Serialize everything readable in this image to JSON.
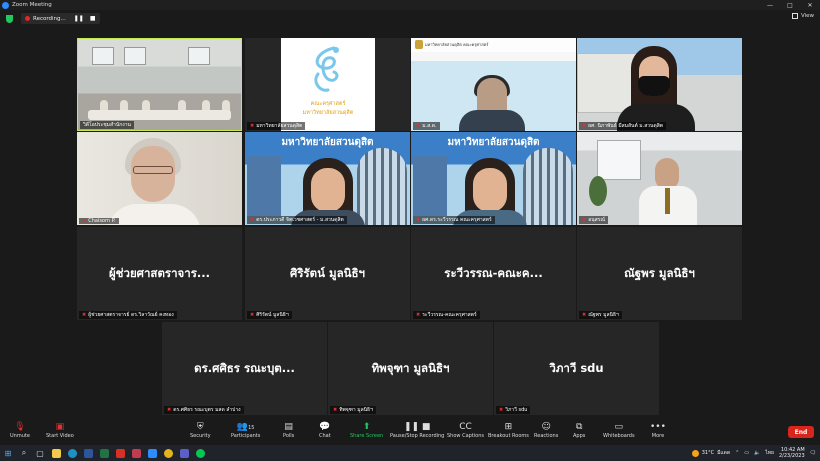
{
  "window": {
    "title": "Zoom Meeting",
    "controls": [
      "—",
      "□",
      "✕"
    ]
  },
  "recording": {
    "label": "Recording...",
    "pause_icon": "pause-icon",
    "stop_icon": "stop-icon"
  },
  "view_button": "View",
  "video_tiles": [
    {
      "name": "วิดีโอประชุมสำนักงาน",
      "scene": "office",
      "active": true
    },
    {
      "name": "มหาวิทยาลัยสวนดุสิต",
      "scene": "logo"
    },
    {
      "name": "ม.ส.ด.",
      "scene": "slide"
    },
    {
      "name": "ผศ. นิภาพันธ์ มีสมสันต์ ม.สวนดุสิต",
      "scene": "building"
    },
    {
      "name": "Chaisorn P.",
      "scene": "oldlady"
    },
    {
      "name": "ดร.ประภาวดี จิตเวชศาสตร์ - ม.สวนดุสิต",
      "scene": "suandusit1"
    },
    {
      "name": "ผศ.ดร.ระวีวรรณ คณะครุศาสตร์",
      "scene": "suandusit2"
    },
    {
      "name": "อนุสรณ์",
      "scene": "man"
    }
  ],
  "logo_text": {
    "line1": "คณะครุศาสตร์",
    "line2": "มหาวิทยาลัยสวนดุสิต"
  },
  "slide_header": "มหาวิทยาลัยสวนดุสิต คณะครุศาสตร์",
  "banner_text": "มหาวิทยาลัยสวนดุสิต",
  "name_tiles": [
    {
      "display": "ผู้ช่วยศาสตราจาร...",
      "tag": "ผู้ช่วยศาสตราจารย์ ดร.วิลาวัณย์ คงทอง"
    },
    {
      "display": "ศิริรัตน์ มูลนิธิฯ",
      "tag": "ศิริรัตน์ มูลนิธิฯ"
    },
    {
      "display": "ระวีวรรณ-คณะค...",
      "tag": "ระวีวรรณ-คณะครุศาสตร์"
    },
    {
      "display": "ณัฐพร มูลนิธิฯ",
      "tag": "ณัฐพร มูลนิธิฯ"
    },
    {
      "display": "ดร.ศศิธร รณะบุต...",
      "tag": "ดร.ศศิธร รณะบุตร มสด ลำปาง"
    },
    {
      "display": "ทิพจุฑา มูลนิธิฯ",
      "tag": "ทิพจุฑา มูลนิธิฯ"
    },
    {
      "display": "วิภาวี sdu",
      "tag": "วิภาวี sdu"
    }
  ],
  "toolbar": {
    "unmute": "Unmute",
    "start_video": "Start Video",
    "security": "Security",
    "participants": "Participants",
    "participants_count": "15",
    "polls": "Polls",
    "chat": "Chat",
    "share_screen": "Share Screen",
    "pause_stop_recording": "Pause/Stop Recording",
    "show_captions": "Show Captions",
    "breakout_rooms": "Breakout Rooms",
    "reactions": "Reactions",
    "apps": "Apps",
    "whiteboards": "Whiteboards",
    "more": "More",
    "end": "End"
  },
  "taskbar": {
    "weather_temp": "31°C",
    "weather_label": "มีแดด",
    "lang": "ไทย",
    "time": "10:42 AM",
    "date": "2/23/2023"
  },
  "colors": {
    "active_speaker": "#c6e84a",
    "share_green": "#23c55e",
    "end_red": "#d9261c",
    "recording_red": "#e02828"
  }
}
